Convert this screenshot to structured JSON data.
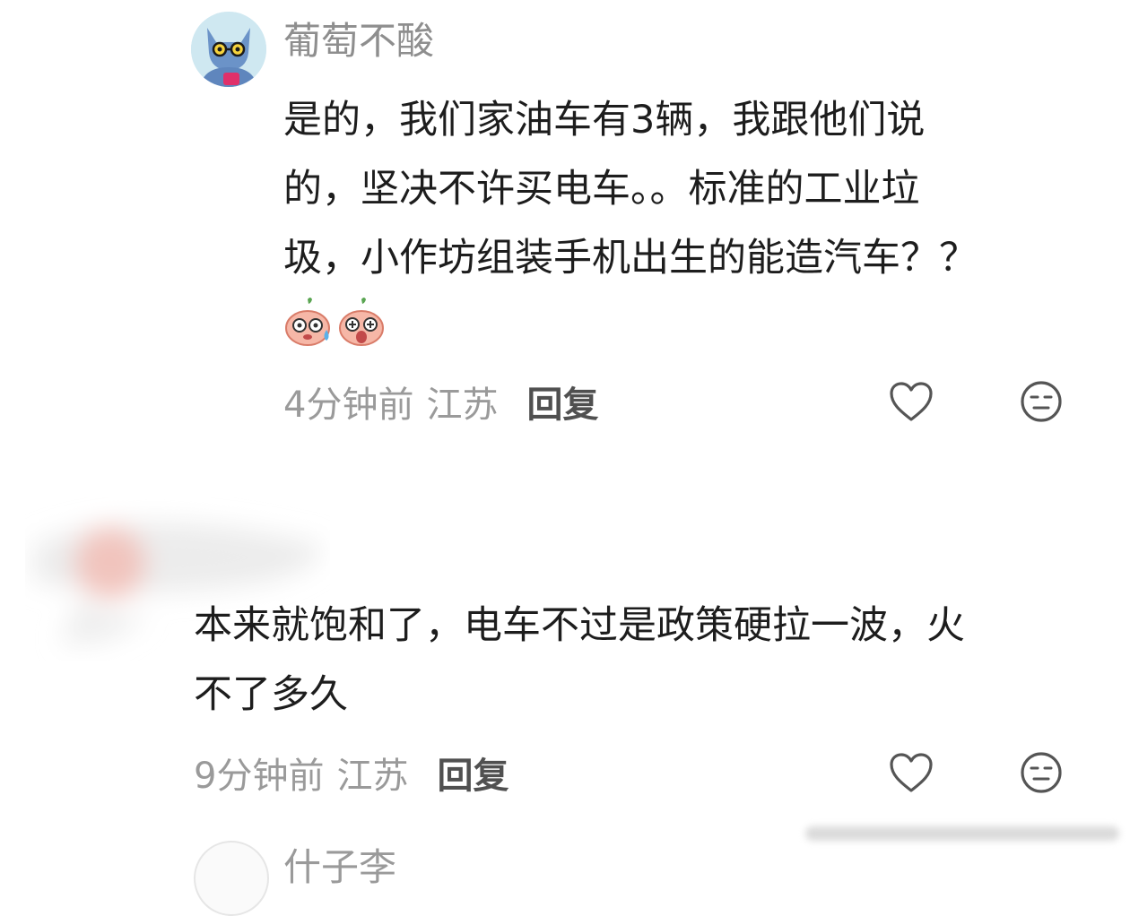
{
  "comments": [
    {
      "username": "葡萄不酸",
      "lines": [
        "是的，我们家油车有3辆，我跟他们说",
        "的，坚决不许买电车。。标准的工业垃",
        "圾，小作坊组装手机出生的能造汽车？？"
      ],
      "emojis": [
        "sweat-emoji",
        "shocked-emoji"
      ],
      "time": "4分钟前",
      "location": "江苏",
      "reply_label": "回复"
    },
    {
      "username": "",
      "lines": [
        "本来就饱和了，电车不过是政策硬拉一波，火",
        "不了多久"
      ],
      "time": "9分钟前",
      "location": "江苏",
      "reply_label": "回复"
    },
    {
      "username": "什子李"
    }
  ],
  "icons": {
    "like": "heart-outline-icon",
    "dislike": "neutral-face-icon"
  },
  "colors": {
    "text": "#1d1d1d",
    "meta": "#9a9a9a",
    "username": "#8e8e8e",
    "icon": "#555555"
  }
}
